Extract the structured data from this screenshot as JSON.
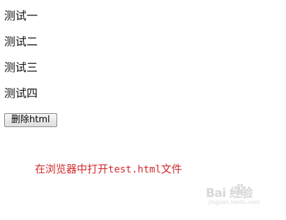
{
  "lines": [
    {
      "text": "测试一"
    },
    {
      "text": "测试二"
    },
    {
      "text": "测试三"
    },
    {
      "text": "测试四"
    }
  ],
  "delete_button": {
    "label": "删除html"
  },
  "caption": {
    "prefix": "在浏览器中打开",
    "code": "test.html",
    "suffix": "文件",
    "color": "#d42b2b"
  },
  "watermark": {
    "brand": "Bai 经验",
    "site": "jingyan.baidu.com"
  }
}
